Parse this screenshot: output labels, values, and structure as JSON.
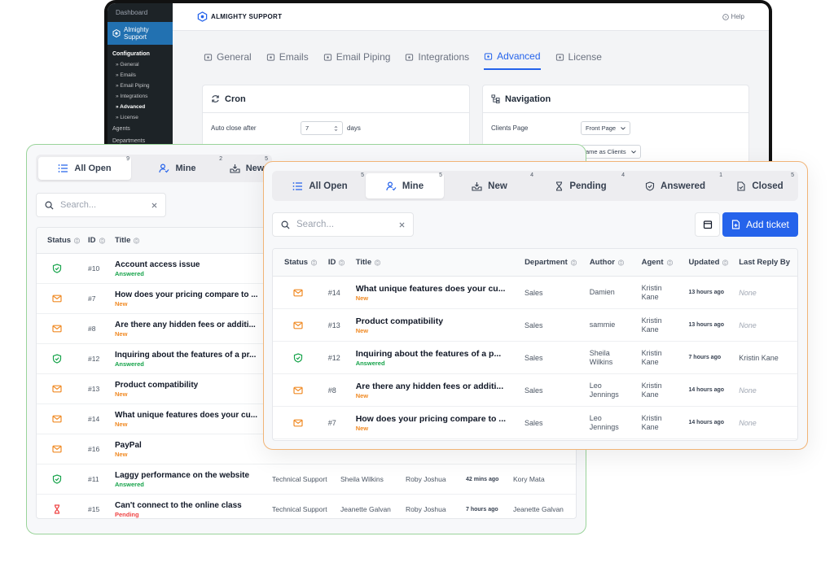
{
  "admin": {
    "sidebar": {
      "dashboard": "Dashboard",
      "plugin": "Almighty Support",
      "section": "Configuration",
      "items": [
        "» General",
        "» Emails",
        "» Email Piping",
        "» Integrations",
        "» Advanced",
        "» License"
      ],
      "active_index": 4,
      "extra": [
        "Agents",
        "Departments"
      ]
    },
    "brand": "ALMIGHTY SUPPORT",
    "help": "Help",
    "tabs": [
      "General",
      "Emails",
      "Email Piping",
      "Integrations",
      "Advanced",
      "License"
    ],
    "active_tab": "Advanced",
    "cron": {
      "title": "Cron",
      "label": "Auto close after",
      "value": "7",
      "unit": "days"
    },
    "navigation": {
      "title": "Navigation",
      "label": "Clients Page",
      "value": "Front Page",
      "second_value": "ame as Clients"
    }
  },
  "left": {
    "tabs": [
      {
        "label": "All Open",
        "count": "9"
      },
      {
        "label": "Mine",
        "count": "2"
      },
      {
        "label": "New",
        "count": "5"
      }
    ],
    "hidden_counts": [
      "4",
      "3",
      "7"
    ],
    "search_placeholder": "Search...",
    "columns": [
      "Status",
      "ID",
      "Title"
    ],
    "rows": [
      {
        "status": "answered",
        "id": "#10",
        "title": "Account access issue",
        "status_label": "Answered",
        "dept": "",
        "author": "",
        "agent": "",
        "updated": "",
        "last": ""
      },
      {
        "status": "new",
        "id": "#7",
        "title": "How does your pricing compare to ...",
        "status_label": "New",
        "dept": "",
        "author": "",
        "agent": "",
        "updated": "",
        "last": ""
      },
      {
        "status": "new",
        "id": "#8",
        "title": "Are there any hidden fees or additi...",
        "status_label": "New",
        "dept": "",
        "author": "",
        "agent": "",
        "updated": "",
        "last": ""
      },
      {
        "status": "answered",
        "id": "#12",
        "title": "Inquiring about the features of a pr...",
        "status_label": "Answered",
        "dept": "",
        "author": "",
        "agent": "",
        "updated": "",
        "last": ""
      },
      {
        "status": "new",
        "id": "#13",
        "title": "Product compatibility",
        "status_label": "New",
        "dept": "",
        "author": "",
        "agent": "",
        "updated": "",
        "last": ""
      },
      {
        "status": "new",
        "id": "#14",
        "title": "What unique features does your cu...",
        "status_label": "New",
        "dept": "",
        "author": "",
        "agent": "",
        "updated": "",
        "last": ""
      },
      {
        "status": "new",
        "id": "#16",
        "title": "PayPal",
        "status_label": "New",
        "dept": "",
        "author": "",
        "agent": "",
        "updated": "",
        "last": ""
      },
      {
        "status": "answered",
        "id": "#11",
        "title": "Laggy performance on the website",
        "status_label": "Answered",
        "dept": "Technical Support",
        "author": "Sheila Wilkins",
        "agent": "Roby Joshua",
        "updated": "42 mins ago",
        "last": "Kory Mata"
      },
      {
        "status": "pending",
        "id": "#15",
        "title": "Can't connect to the online class",
        "status_label": "Pending",
        "dept": "Technical Support",
        "author": "Jeanette Galvan",
        "agent": "Roby Joshua",
        "updated": "7 hours ago",
        "last": "Jeanette Galvan"
      }
    ]
  },
  "right": {
    "tabs": [
      {
        "label": "All Open",
        "count": "5"
      },
      {
        "label": "Mine",
        "count": "5"
      },
      {
        "label": "New",
        "count": "4"
      },
      {
        "label": "Pending",
        "count": "4"
      },
      {
        "label": "Answered",
        "count": "1"
      },
      {
        "label": "Closed",
        "count": "5"
      }
    ],
    "active_tab": "Mine",
    "search_placeholder": "Search...",
    "add_button": "Add ticket",
    "columns": [
      "Status",
      "ID",
      "Title",
      "Department",
      "Author",
      "Agent",
      "Updated",
      "Last Reply By"
    ],
    "rows": [
      {
        "status": "new",
        "id": "#14",
        "title": "What unique features does your cu...",
        "status_label": "New",
        "dept": "Sales",
        "author": "Damien",
        "agent1": "Kristin",
        "agent2": "Kane",
        "updated": "13 hours ago",
        "last": "None",
        "none": true
      },
      {
        "status": "new",
        "id": "#13",
        "title": "Product compatibility",
        "status_label": "New",
        "dept": "Sales",
        "author": "sammie",
        "agent1": "Kristin",
        "agent2": "Kane",
        "updated": "13 hours ago",
        "last": "None",
        "none": true
      },
      {
        "status": "answered",
        "id": "#12",
        "title": "Inquiring about the features of a p...",
        "status_label": "Answered",
        "dept": "Sales",
        "author": "Sheila Wilkins",
        "agent1": "Kristin",
        "agent2": "Kane",
        "updated": "7 hours ago",
        "last": "Kristin Kane",
        "none": false
      },
      {
        "status": "new",
        "id": "#8",
        "title": "Are there any hidden fees or additi...",
        "status_label": "New",
        "dept": "Sales",
        "author": "Leo Jennings",
        "agent1": "Kristin",
        "agent2": "Kane",
        "updated": "14 hours ago",
        "last": "None",
        "none": true
      },
      {
        "status": "new",
        "id": "#7",
        "title": "How does your pricing compare to ...",
        "status_label": "New",
        "dept": "Sales",
        "author": "Leo Jennings",
        "agent1": "Kristin",
        "agent2": "Kane",
        "updated": "14 hours ago",
        "last": "None",
        "none": true
      }
    ]
  },
  "colors": {
    "primary": "#2563eb",
    "new": "#f08a24",
    "answered": "#16a34a",
    "pending": "#ef4444",
    "left_border": "#9ad49a",
    "right_border": "#f1b477"
  }
}
